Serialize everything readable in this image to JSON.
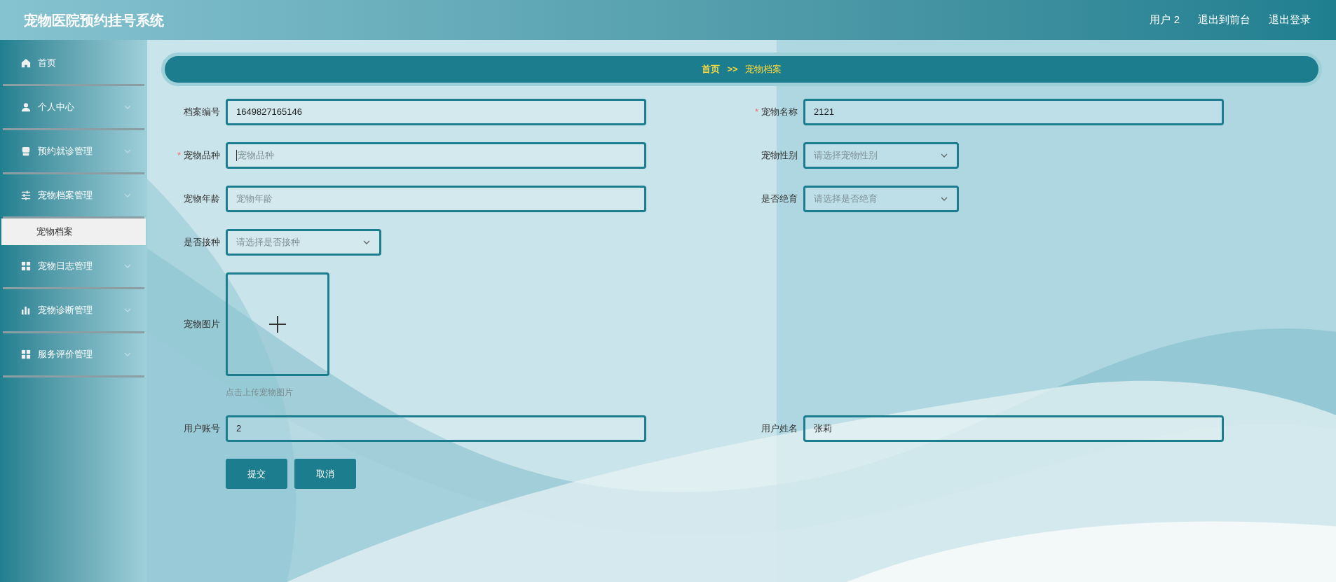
{
  "header": {
    "title": "宠物医院预约挂号系统",
    "links": [
      "用户 2",
      "退出到前台",
      "退出登录"
    ]
  },
  "sidebar": {
    "items": [
      {
        "label": "首页",
        "has_arrow": false
      },
      {
        "label": "个人中心",
        "has_arrow": true
      },
      {
        "label": "预约就诊管理",
        "has_arrow": true
      },
      {
        "label": "宠物档案管理",
        "has_arrow": true,
        "expanded": true,
        "children": [
          {
            "label": "宠物档案",
            "selected": true
          }
        ]
      },
      {
        "label": "宠物日志管理",
        "has_arrow": true
      },
      {
        "label": "宠物诊断管理",
        "has_arrow": true
      },
      {
        "label": "服务评价管理",
        "has_arrow": true
      }
    ]
  },
  "breadcrumb": {
    "home": "首页",
    "separator": ">>",
    "current": "宠物档案"
  },
  "form": {
    "rows": [
      [
        {
          "label": "档案编号",
          "kind": "text",
          "value": "1649827165146"
        },
        {
          "label": "宠物名称",
          "kind": "text",
          "required_mark": "*",
          "value": "2121"
        }
      ],
      [
        {
          "label": "宠物品种",
          "kind": "text",
          "required_mark": "*",
          "placeholder": "宠物品种",
          "focused": true
        },
        {
          "label": "宠物性别",
          "kind": "select",
          "placeholder": "请选择宠物性别"
        }
      ],
      [
        {
          "label": "宠物年龄",
          "kind": "text",
          "placeholder": "宠物年龄"
        },
        {
          "label": "是否绝育",
          "kind": "select",
          "placeholder": "请选择是否绝育"
        }
      ],
      [
        {
          "label": "是否接种",
          "kind": "select",
          "placeholder": "请选择是否接种"
        }
      ],
      [
        {
          "label": "宠物图片",
          "kind": "upload",
          "hint": "点击上传宠物图片"
        }
      ],
      [
        {
          "label": "用户账号",
          "kind": "text",
          "value": "2"
        },
        {
          "label": "用户姓名",
          "kind": "text",
          "value": "张莉"
        }
      ]
    ],
    "buttons": [
      "提交",
      "取消"
    ]
  }
}
